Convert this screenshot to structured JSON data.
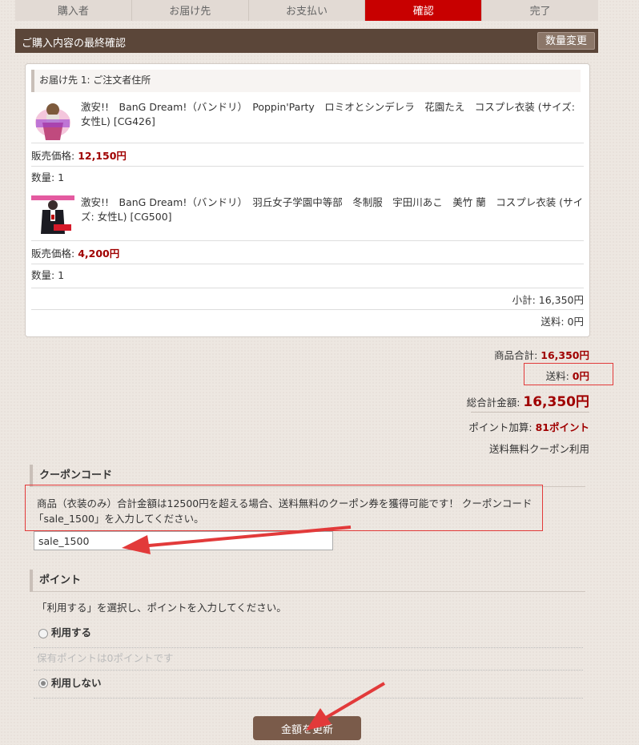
{
  "steps": [
    {
      "top": "",
      "label": "購入者"
    },
    {
      "top": "",
      "label": "お届け先"
    },
    {
      "top": "",
      "label": "お支払い"
    },
    {
      "top": "",
      "label": "確認"
    },
    {
      "top": "",
      "label": "完了"
    }
  ],
  "header": {
    "title": "ご購入内容の最終確認",
    "change_qty_button": "数量変更"
  },
  "order": {
    "address": "お届け先 1: ご注文者住所",
    "items": [
      {
        "name": "激安!!　BanG Dream!（バンドリ）　Poppin'Party　ロミオとシンデレラ　花園たえ　コスプレ衣装 (サイズ: 女性L) [CG426]",
        "price_label": "販売価格: ",
        "price": "12,150円",
        "qty_label": "数量: 1"
      },
      {
        "name": "激安!!　BanG Dream!（バンドリ）　羽丘女子学園中等部　冬制服　宇田川あこ　美竹 蘭　コスプレ衣装 (サイズ: 女性L) [CG500]",
        "price_label": "販売価格: ",
        "price": "4,200円",
        "qty_label": "数量: 1"
      }
    ],
    "subtotal": "小計: 16,350円",
    "shipping": "送料: 0円"
  },
  "totals": {
    "goods_label": "商品合計: ",
    "goods_value": "16,350円",
    "shipping_label": "送料: ",
    "shipping_value": "0円",
    "grand_label": "総合計金額: ",
    "grand_value": "16,350円",
    "points_label": "ポイント加算: ",
    "points_value": "81ポイント",
    "coupon_note": "送料無料クーポン利用"
  },
  "coupon": {
    "heading": "クーポンコード",
    "message_line1": "商品（衣装のみ）合計金額は12500円を超える場合、送料無料のクーポン券を獲得可能です！ クーポンコード",
    "message_line2": "「sale_1500」を入力してください。",
    "input_value": "sale_1500"
  },
  "points": {
    "heading": "ポイント",
    "instruction": "「利用する」を選択し、ポイントを入力してください。",
    "use_label": "利用する",
    "held_note": "保有ポイントは0ポイントです",
    "not_use_label": "利用しない"
  },
  "update_button": "金額を更新",
  "colors": {
    "accent_red": "#c80000",
    "brown_header": "#5b4639",
    "annotation_red": "#e23a3a"
  }
}
